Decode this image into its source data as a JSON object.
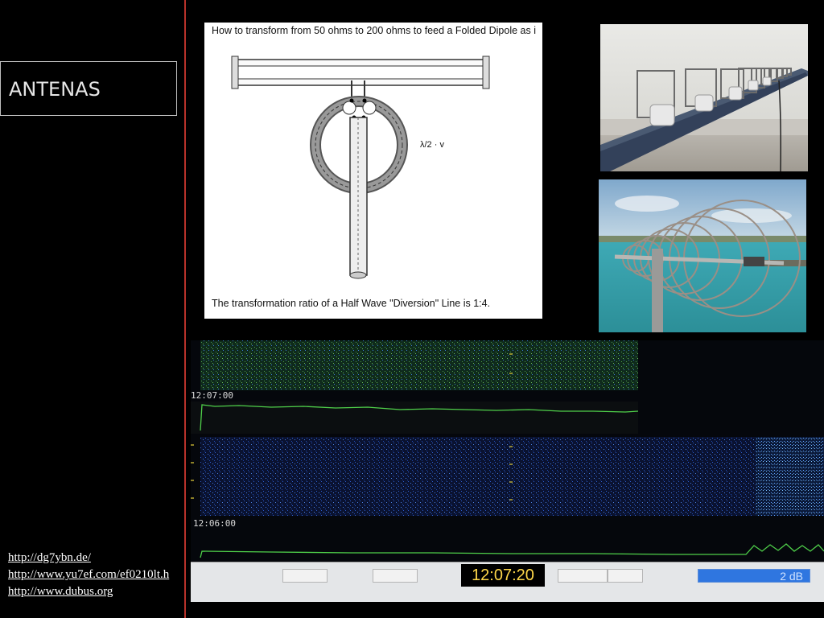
{
  "slide": {
    "title": "ANTENAS",
    "links": [
      "http://dg7ybn.de/",
      "http://www.yu7ef.com/ef0210lt.h",
      "http://www.dubus.org"
    ]
  },
  "diagram": {
    "heading": "How to transform from 50 ohms to 200 ohms to feed a Folded Dipole as i",
    "label": "λ/2 · v",
    "footer": "The transformation ratio of a Half Wave \"Diversion\" Line is 1:4."
  },
  "photos": {
    "yagi_loops": "yagi-loop-antenna-photo",
    "quad_loops": "circular-loop-antenna-photo"
  },
  "spectrogram": {
    "timestamp_top": "12:07:00",
    "timestamp_bottom": "12:06:00",
    "clock": "12:07:20",
    "gain": "2 dB",
    "colors": {
      "signal": "#4fd04a",
      "waterfall_blue": "#1e3f9a",
      "waterfall_green": "#2e7a3a"
    }
  }
}
